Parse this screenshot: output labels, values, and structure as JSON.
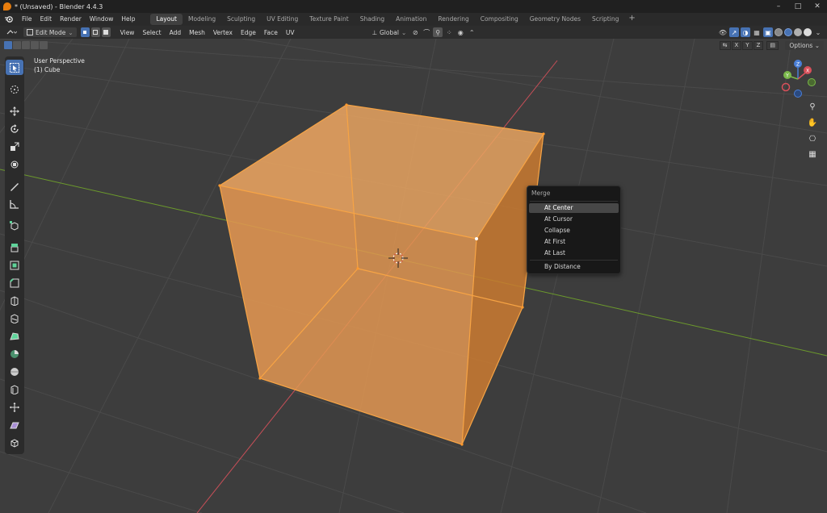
{
  "window": {
    "title": "* (Unsaved) - Blender 4.4.3",
    "controls": [
      "–",
      "□",
      "✕"
    ]
  },
  "menubar": {
    "items": [
      "File",
      "Edit",
      "Render",
      "Window",
      "Help"
    ],
    "workspaces": [
      "Layout",
      "Modeling",
      "Sculpting",
      "UV Editing",
      "Texture Paint",
      "Shading",
      "Animation",
      "Rendering",
      "Compositing",
      "Geometry Nodes",
      "Scripting"
    ],
    "active_workspace": "Layout",
    "add_tab": "+"
  },
  "header": {
    "mode": "Edit Mode",
    "menus": [
      "View",
      "Select",
      "Add",
      "Mesh",
      "Vertex",
      "Edge",
      "Face",
      "UV"
    ],
    "transform_orientation": "Global"
  },
  "viewport": {
    "view_name": "User Perspective",
    "object_name": "(1) Cube",
    "axis_toggles": [
      "X",
      "Y",
      "Z"
    ],
    "options_label": "Options",
    "gizmo_axes": {
      "x": "X",
      "y": "Y",
      "z": "Z"
    },
    "colors": {
      "background": "#3d3d3d",
      "grid": "#4a4a4a",
      "x_axis": "#c84f58",
      "y_axis": "#6c9a2c",
      "selection": "#f3a14b",
      "active_tool": "#4772b3"
    }
  },
  "merge_menu": {
    "title": "Merge",
    "items": [
      "At Center",
      "At Cursor",
      "Collapse",
      "At First",
      "At Last",
      "By Distance"
    ],
    "highlighted": "At Center"
  },
  "toolbar": {
    "tools": [
      "select-box",
      "cursor",
      "move",
      "rotate",
      "scale",
      "transform",
      "annotate",
      "measure",
      "add-cube",
      "extrude-region",
      "inset-faces",
      "bevel",
      "loop-cut",
      "knife",
      "poly-build",
      "spin",
      "smooth",
      "edge-slide",
      "shrink-fatten",
      "shear",
      "rip-region"
    ]
  }
}
